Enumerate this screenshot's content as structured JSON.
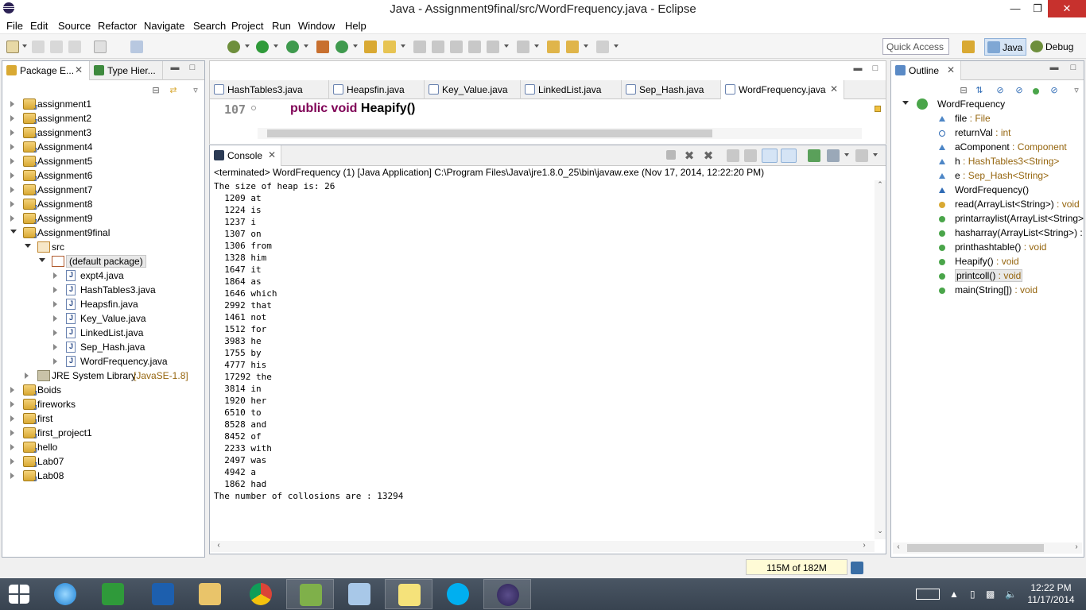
{
  "window": {
    "title": "Java - Assignment9final/src/WordFrequency.java - Eclipse"
  },
  "menu": [
    "File",
    "Edit",
    "Source",
    "Refactor",
    "Navigate",
    "Search",
    "Project",
    "Run",
    "Window",
    "Help"
  ],
  "toolbar": {
    "quick_access": "Quick Access"
  },
  "perspectives": {
    "java": "Java",
    "debug": "Debug"
  },
  "package_explorer": {
    "tab1": "Package E...",
    "tab2": "Type Hier...",
    "items": [
      {
        "label": "assignment1",
        "level": 0,
        "state": "collapsed",
        "type": "project"
      },
      {
        "label": "assignment2",
        "level": 0,
        "state": "collapsed",
        "type": "project"
      },
      {
        "label": "assignment3",
        "level": 0,
        "state": "collapsed",
        "type": "project"
      },
      {
        "label": "Assignment4",
        "level": 0,
        "state": "collapsed",
        "type": "project"
      },
      {
        "label": "Assignment5",
        "level": 0,
        "state": "collapsed",
        "type": "project"
      },
      {
        "label": "Assignment6",
        "level": 0,
        "state": "collapsed",
        "type": "project"
      },
      {
        "label": "Assignment7",
        "level": 0,
        "state": "collapsed",
        "type": "project"
      },
      {
        "label": "Assignment8",
        "level": 0,
        "state": "collapsed",
        "type": "project"
      },
      {
        "label": "Assignment9",
        "level": 0,
        "state": "collapsed",
        "type": "project"
      },
      {
        "label": "Assignment9final",
        "level": 0,
        "state": "expanded",
        "type": "project"
      },
      {
        "label": "src",
        "level": 1,
        "state": "expanded",
        "type": "src"
      },
      {
        "label": "(default package)",
        "level": 2,
        "state": "expanded",
        "type": "package"
      },
      {
        "label": "expt4.java",
        "level": 3,
        "state": "collapsed",
        "type": "java"
      },
      {
        "label": "HashTables3.java",
        "level": 3,
        "state": "collapsed",
        "type": "java"
      },
      {
        "label": "Heapsfin.java",
        "level": 3,
        "state": "collapsed",
        "type": "java"
      },
      {
        "label": "Key_Value.java",
        "level": 3,
        "state": "collapsed",
        "type": "java"
      },
      {
        "label": "LinkedList.java",
        "level": 3,
        "state": "collapsed",
        "type": "java"
      },
      {
        "label": "Sep_Hash.java",
        "level": 3,
        "state": "collapsed",
        "type": "java"
      },
      {
        "label": "WordFrequency.java",
        "level": 3,
        "state": "collapsed",
        "type": "java"
      },
      {
        "label": "JRE System Library",
        "suffix": "[JavaSE-1.8]",
        "level": 1,
        "state": "collapsed",
        "type": "lib"
      },
      {
        "label": "Boids",
        "level": 0,
        "state": "collapsed",
        "type": "project"
      },
      {
        "label": "fireworks",
        "level": 0,
        "state": "collapsed",
        "type": "project"
      },
      {
        "label": "first",
        "level": 0,
        "state": "collapsed",
        "type": "project"
      },
      {
        "label": "first_project1",
        "level": 0,
        "state": "collapsed",
        "type": "project"
      },
      {
        "label": "hello",
        "level": 0,
        "state": "collapsed",
        "type": "project"
      },
      {
        "label": "Lab07",
        "level": 0,
        "state": "collapsed",
        "type": "project"
      },
      {
        "label": "Lab08",
        "level": 0,
        "state": "collapsed",
        "type": "project"
      }
    ]
  },
  "editor": {
    "tabs": [
      "HashTables3.java",
      "Heapsfin.java",
      "Key_Value.java",
      "LinkedList.java",
      "Sep_Hash.java",
      "WordFrequency.java"
    ],
    "active_tab": "WordFrequency.java",
    "line_number": "107",
    "code_keyword": "public void",
    "code_method": "Heapify()"
  },
  "console": {
    "tab": "Console",
    "header": "<terminated> WordFrequency (1) [Java Application] C:\\Program Files\\Java\\jre1.8.0_25\\bin\\javaw.exe (Nov 17, 2014, 12:22:20 PM)",
    "lines": [
      "The size of heap is: 26",
      "  1209 at",
      "  1224 is",
      "  1237 i",
      "  1307 on",
      "  1306 from",
      "  1328 him",
      "  1647 it",
      "  1864 as",
      "  1646 which",
      "  2992 that",
      "  1461 not",
      "  1512 for",
      "  3983 he",
      "  1755 by",
      "  4777 his",
      "  17292 the",
      "  3814 in",
      "  1920 her",
      "  6510 to",
      "  8528 and",
      "  8452 of",
      "  2233 with",
      "  2497 was",
      "  4942 a",
      "  1862 had",
      "The number of collosions are : 13294"
    ]
  },
  "outline": {
    "tab": "Outline",
    "class_name": "WordFrequency",
    "members": [
      {
        "name": "file",
        "type": " : File",
        "kind": "field"
      },
      {
        "name": "returnVal",
        "type": " : int",
        "kind": "field-default"
      },
      {
        "name": "aComponent",
        "type": " : Component",
        "kind": "field"
      },
      {
        "name": "h",
        "type": " : HashTables3<String>",
        "kind": "field"
      },
      {
        "name": "e",
        "type": " : Sep_Hash<String>",
        "kind": "field"
      },
      {
        "name": "WordFrequency()",
        "type": "",
        "kind": "constructor"
      },
      {
        "name": "read(ArrayList<String>)",
        "type": " : void",
        "kind": "method-warn"
      },
      {
        "name": "printarraylist(ArrayList<String>",
        "type": "",
        "kind": "method"
      },
      {
        "name": "hasharray(ArrayList<String>) :",
        "type": "",
        "kind": "method"
      },
      {
        "name": "printhashtable()",
        "type": " : void",
        "kind": "method"
      },
      {
        "name": "Heapify()",
        "type": " : void",
        "kind": "method"
      },
      {
        "name": "printcoll()",
        "type": " : void",
        "kind": "method"
      },
      {
        "name": "main(String[])",
        "type": " : void",
        "kind": "method-static"
      }
    ],
    "selected": "printcoll()"
  },
  "status": {
    "heap": "115M of 182M"
  },
  "taskbar": {
    "time": "12:22 PM",
    "date": "11/17/2014"
  },
  "colors": {
    "keyword": "#7f0055",
    "type_hint": "#95650e",
    "selection": "#d9e8fb"
  }
}
